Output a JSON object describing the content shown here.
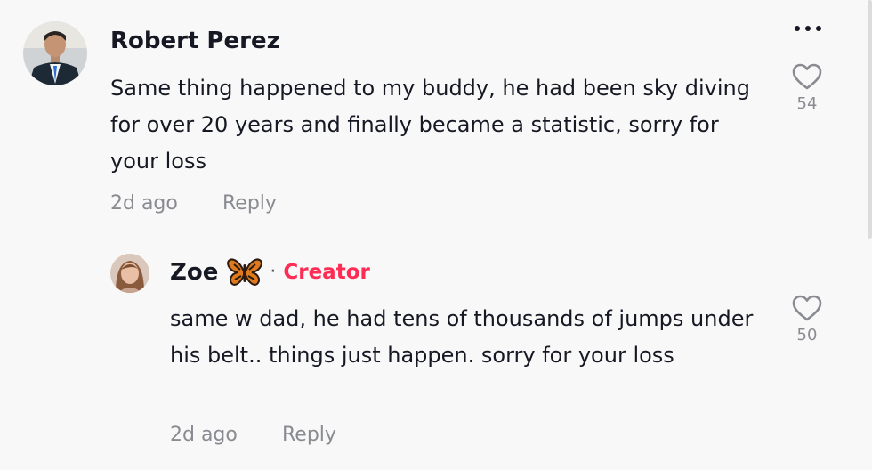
{
  "colors": {
    "background": "#f8f8f8",
    "text": "#161823",
    "muted": "#8a8b91",
    "creator_accent": "#fe2c55"
  },
  "more_menu": {
    "icon": "more-horizontal-icon"
  },
  "comments": [
    {
      "username": "Robert Perez",
      "text": "Same thing happened to my buddy, he had been sky diving for over 20 years and finally became a statistic, sorry for your loss",
      "time": "2d ago",
      "reply_label": "Reply",
      "likes": "54",
      "like_icon": "heart-outline-icon"
    },
    {
      "username": "Zoe",
      "username_emoji": "butterfly-icon",
      "separator": "·",
      "badge": "Creator",
      "text": "same w dad, he had tens of thousands of jumps under his belt.. things just happen. sorry for your loss",
      "time": "2d ago",
      "reply_label": "Reply",
      "likes": "50",
      "like_icon": "heart-outline-icon"
    }
  ]
}
